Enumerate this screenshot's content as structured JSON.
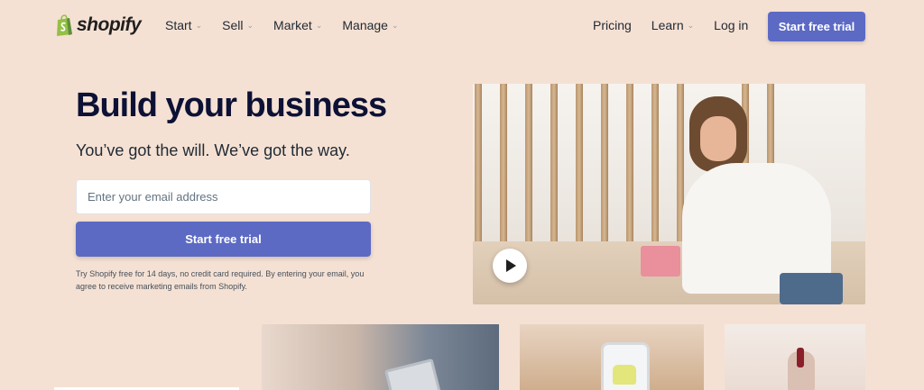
{
  "nav": {
    "logo_text": "shopify",
    "left_items": [
      "Start",
      "Sell",
      "Market",
      "Manage"
    ],
    "pricing": "Pricing",
    "learn": "Learn",
    "login": "Log in",
    "cta": "Start free trial"
  },
  "hero": {
    "title": "Build your business",
    "subtitle": "You’ve got the will. We’ve got the way.",
    "email_placeholder": "Enter your email address",
    "cta": "Start free trial",
    "disclaimer": "Try Shopify free for 14 days, no credit card required. By entering your email, you agree to receive marketing emails from Shopify."
  },
  "colors": {
    "background": "#f5e1d3",
    "accent": "#5c6ac4",
    "heading": "#0c1135"
  },
  "icons": {
    "logo": "shopify-bag-icon",
    "dropdown": "chevron-down-icon",
    "play": "play-icon"
  }
}
